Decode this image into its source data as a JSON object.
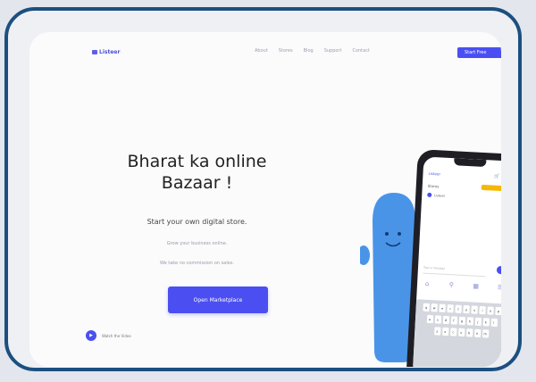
{
  "nav": {
    "logo": "Listeer",
    "links": [
      "About",
      "Stores",
      "Blog",
      "Support",
      "Contact"
    ],
    "start_label": "Start Free"
  },
  "hero": {
    "title": "Bharat ka online Bazaar !",
    "subtitle": "Start your own digital store.",
    "line1": "Grow your business online.",
    "line2": "We take no commission on sales.",
    "cta_label": "Open Marketplace",
    "watch_label": "Watch the Video"
  },
  "phone": {
    "app_title": "Listeer",
    "section": "Stores",
    "item": "Listeer",
    "input_placeholder": "Type a message",
    "keys": [
      [
        "q",
        "w",
        "e",
        "r",
        "t",
        "y",
        "u",
        "i",
        "o",
        "p"
      ],
      [
        "a",
        "s",
        "d",
        "f",
        "g",
        "h",
        "j",
        "k",
        "l"
      ],
      [
        "z",
        "x",
        "c",
        "v",
        "b",
        "n",
        "m"
      ]
    ]
  },
  "colors": {
    "accent": "#4b4ff1",
    "frame": "#1c4f80",
    "mascot": "#4a94e8"
  }
}
